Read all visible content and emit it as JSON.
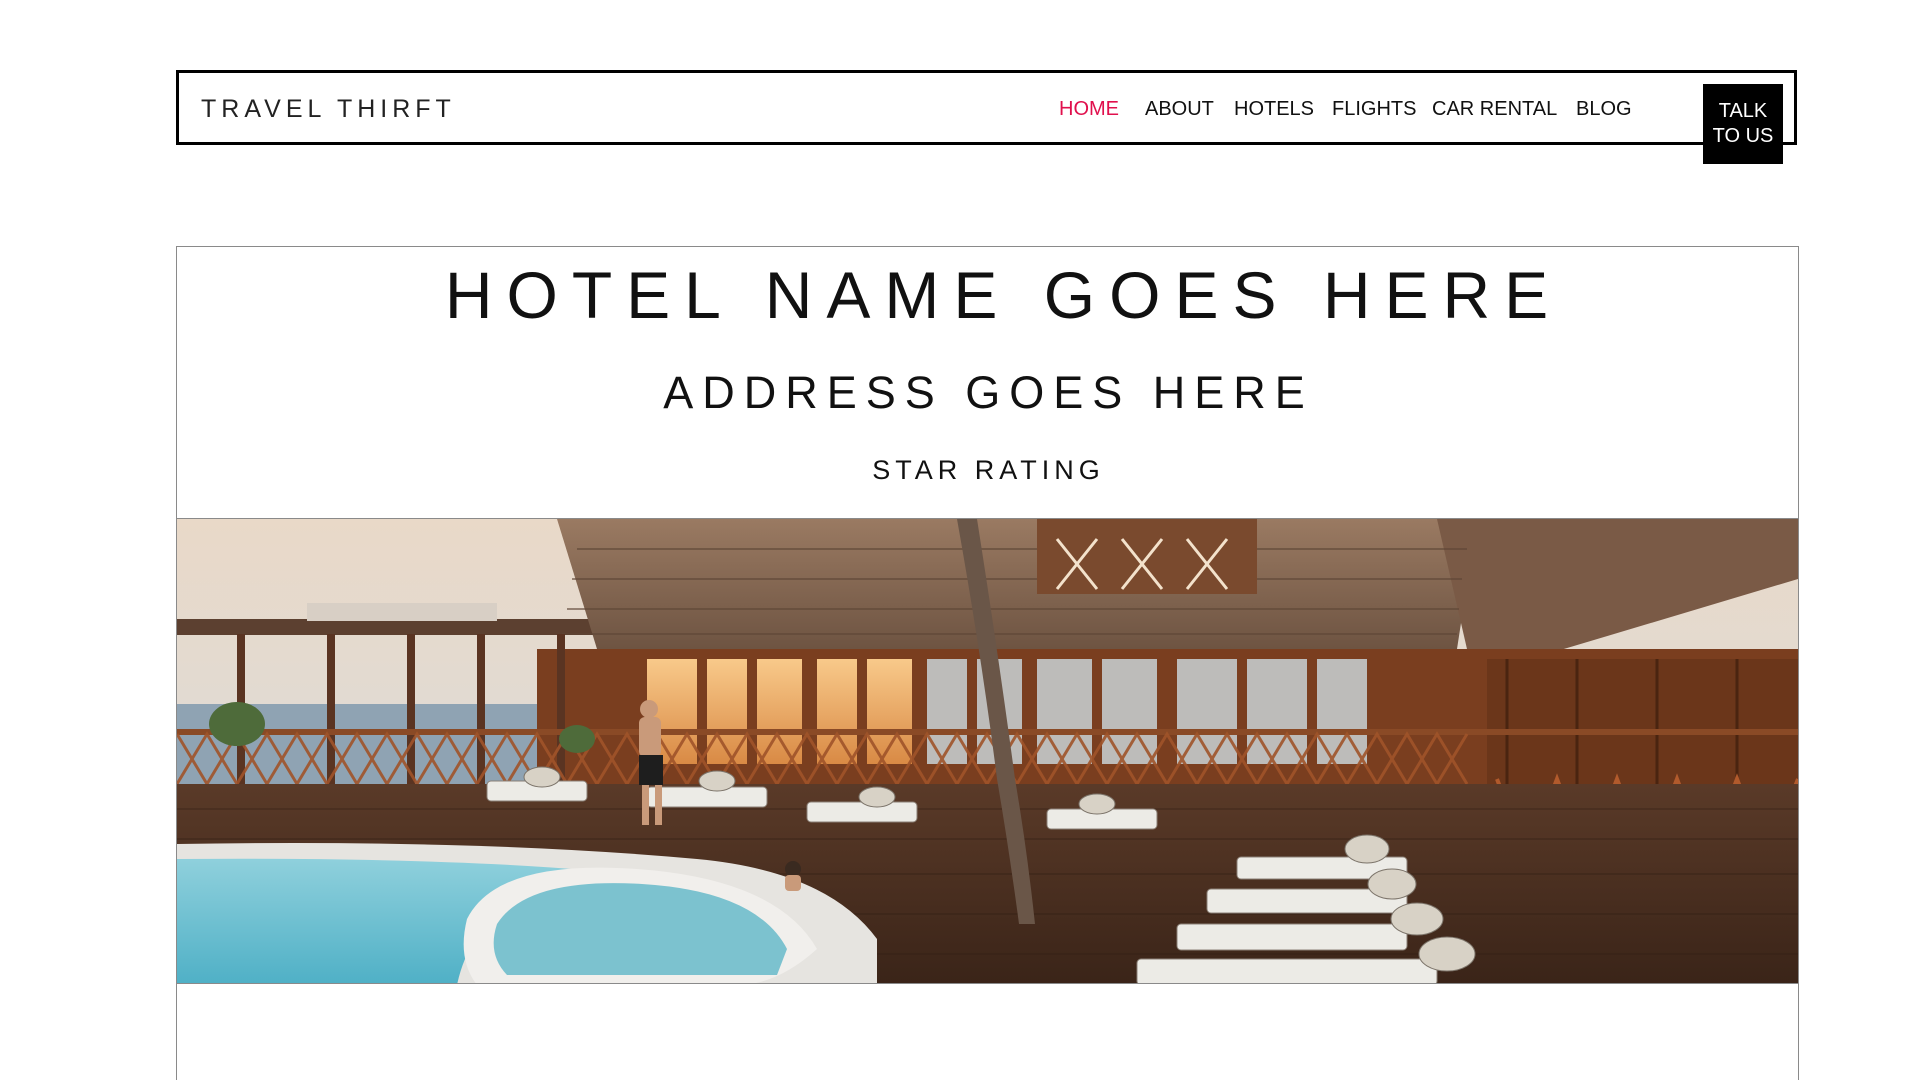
{
  "header": {
    "brand": "TRAVEL THIRFT",
    "nav": [
      {
        "label": "HOME",
        "active": true
      },
      {
        "label": "ABOUT",
        "active": false
      },
      {
        "label": "HOTELS",
        "active": false
      },
      {
        "label": "FLIGHTS",
        "active": false
      },
      {
        "label": "CAR RENTAL",
        "active": false
      },
      {
        "label": "BLOG",
        "active": false
      }
    ],
    "cta_label": "TALK TO US"
  },
  "hotel": {
    "name": "HOTEL NAME GOES HERE",
    "address": "ADDRESS GOES HERE",
    "star_rating": "STAR RATING"
  },
  "hero": {
    "image": "resort-pool-deck-photo"
  },
  "colors": {
    "accent": "#e0104d",
    "border": "#000000",
    "cta_bg": "#000000",
    "cta_text": "#ffffff"
  }
}
